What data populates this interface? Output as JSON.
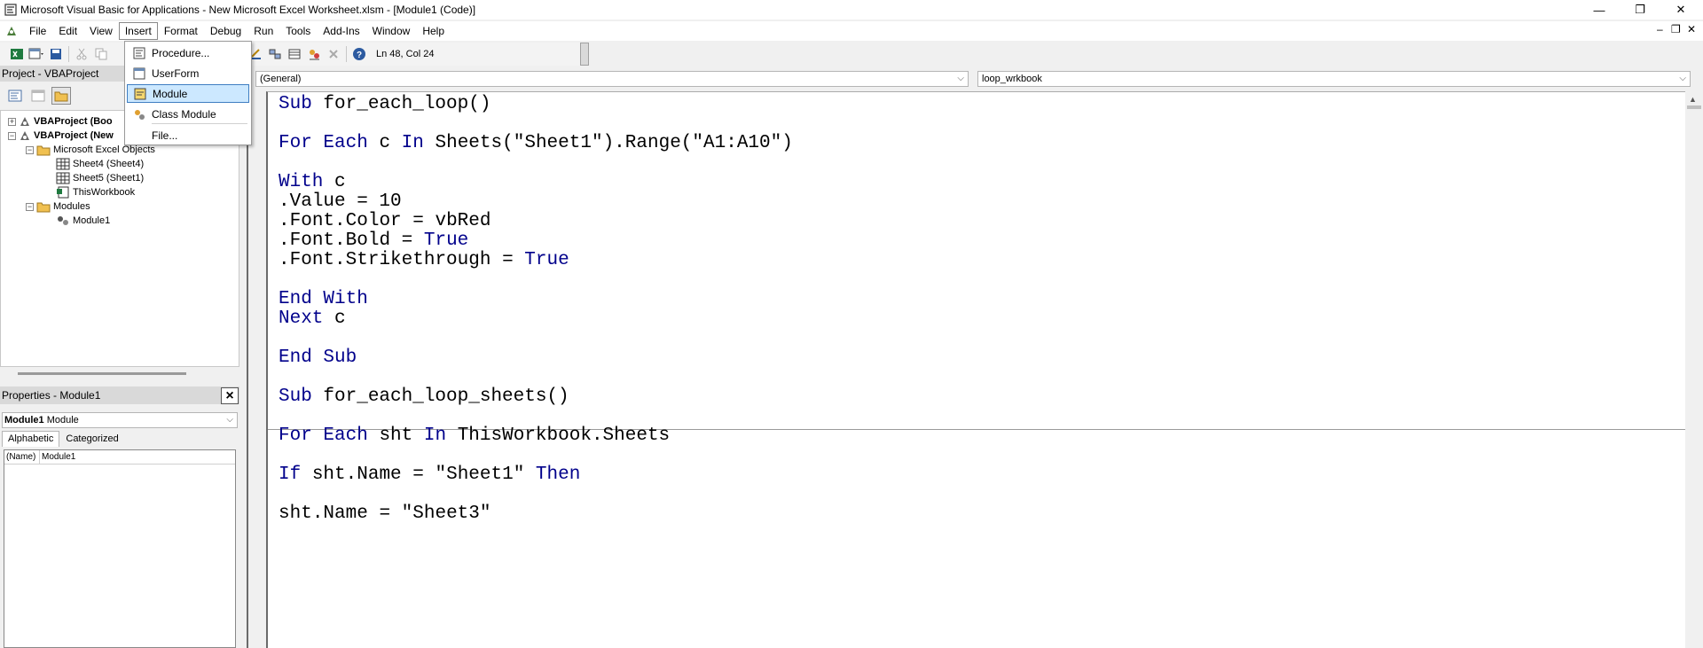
{
  "window": {
    "title": "Microsoft Visual Basic for Applications - New Microsoft Excel Worksheet.xlsm - [Module1 (Code)]",
    "minimize": "—",
    "maximize": "❐",
    "close": "✕"
  },
  "menubar": {
    "items": [
      "File",
      "Edit",
      "View",
      "Insert",
      "Format",
      "Debug",
      "Run",
      "Tools",
      "Add-Ins",
      "Window",
      "Help"
    ],
    "open_menu": "Insert"
  },
  "toolbar": {
    "status": "Ln 48, Col 24"
  },
  "insert_menu": {
    "items": [
      "Procedure...",
      "UserForm",
      "Module",
      "Class Module",
      "File..."
    ],
    "selected": "Module"
  },
  "project": {
    "title": "Project - VBAProject",
    "tree": [
      {
        "label": "VBAProject (Boo",
        "bold": true
      },
      {
        "label": "VBAProject (New",
        "bold": true
      },
      {
        "label": "Microsoft Excel Objects",
        "bold": false
      },
      {
        "label": "Sheet4 (Sheet4)",
        "bold": false
      },
      {
        "label": "Sheet5 (Sheet1)",
        "bold": false
      },
      {
        "label": "ThisWorkbook",
        "bold": false
      },
      {
        "label": "Modules",
        "bold": false
      },
      {
        "label": "Module1",
        "bold": false
      }
    ]
  },
  "properties": {
    "title": "Properties - Module1",
    "object_bold": "Module1",
    "object_type": "Module",
    "tabs": [
      "Alphabetic",
      "Categorized"
    ],
    "rows": [
      {
        "key": "(Name)",
        "value": "Module1"
      }
    ]
  },
  "code": {
    "object_combo": "(General)",
    "procedure_combo": "loop_wrkbook",
    "lines": [
      "Sub for_each_loop()",
      "",
      "For Each c In Sheets(\"Sheet1\").Range(\"A1:A10\")",
      "",
      "With c",
      ".Value = 10",
      ".Font.Color = vbRed",
      ".Font.Bold = True",
      ".Font.Strikethrough = True",
      "",
      "End With",
      "Next c",
      "",
      "End Sub",
      "",
      "Sub for_each_loop_sheets()",
      "",
      "For Each sht In ThisWorkbook.Sheets",
      "",
      "If sht.Name = \"Sheet1\" Then",
      "",
      "sht.Name = \"Sheet3\""
    ]
  },
  "colors": {
    "keyword": "#00008b",
    "selection": "#cce8ff"
  }
}
